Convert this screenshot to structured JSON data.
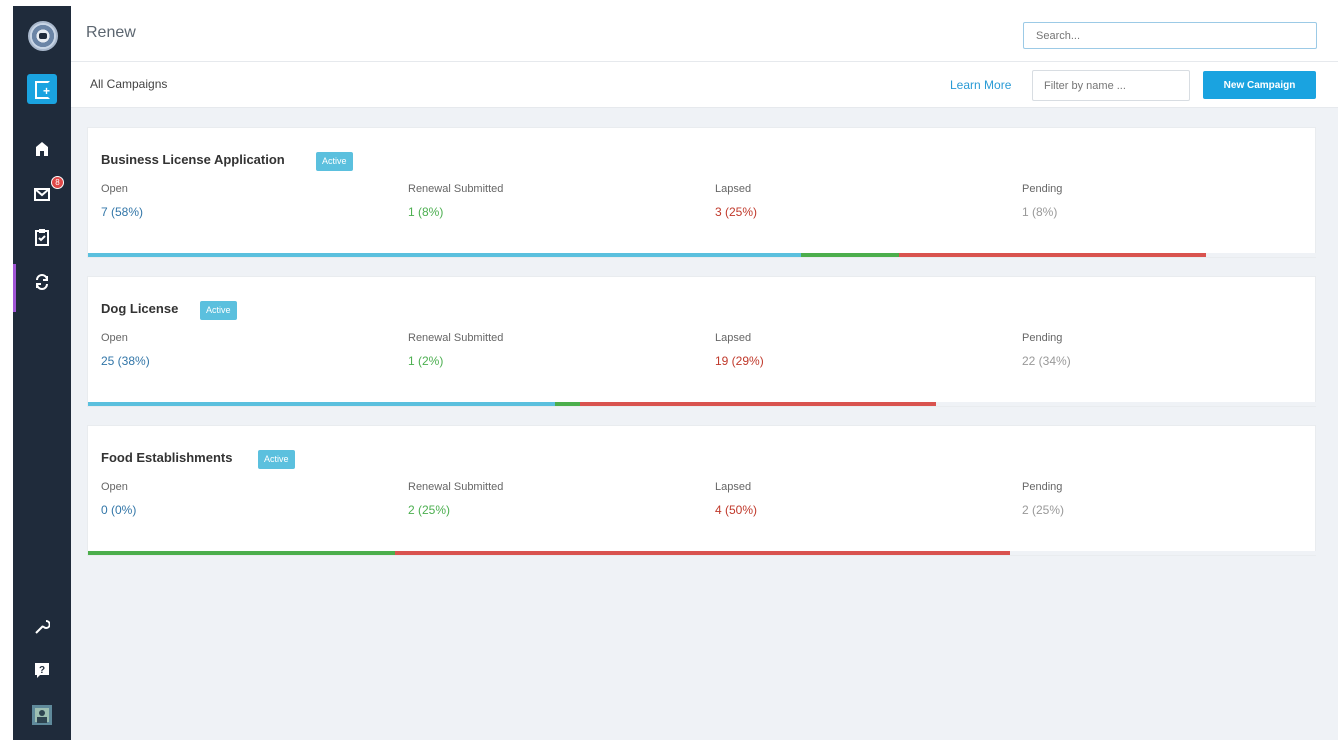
{
  "header": {
    "title": "Renew",
    "search_placeholder": "Search..."
  },
  "subbar": {
    "title": "All Campaigns",
    "learn_more": "Learn More",
    "filter_placeholder": "Filter by name ...",
    "new_button": "New Campaign"
  },
  "sidebar": {
    "badge_count": "8"
  },
  "stat_labels": {
    "open": "Open",
    "renewal": "Renewal Submitted",
    "lapsed": "Lapsed",
    "pending": "Pending"
  },
  "colors": {
    "open": "#5bc0de",
    "renewal": "#4cae4c",
    "lapsed": "#d9534f",
    "accent": "#1aa3e0"
  },
  "campaigns": [
    {
      "name": "Business License Application",
      "status": "Active",
      "open": "7 (58%)",
      "renewal": "1 (8%)",
      "lapsed": "3 (25%)",
      "pending": "1 (8%)",
      "progress": {
        "open": 0.58,
        "renewal": 0.08,
        "lapsed": 0.25
      }
    },
    {
      "name": "Dog License",
      "status": "Active",
      "open": "25 (38%)",
      "renewal": "1 (2%)",
      "lapsed": "19 (29%)",
      "pending": "22 (34%)",
      "progress": {
        "open": 0.38,
        "renewal": 0.02,
        "lapsed": 0.29
      }
    },
    {
      "name": "Food Establishments",
      "status": "Active",
      "open": "0 (0%)",
      "renewal": "2 (25%)",
      "lapsed": "4 (50%)",
      "pending": "2 (25%)",
      "progress": {
        "open": 0.0,
        "renewal": 0.25,
        "lapsed": 0.5
      }
    }
  ]
}
